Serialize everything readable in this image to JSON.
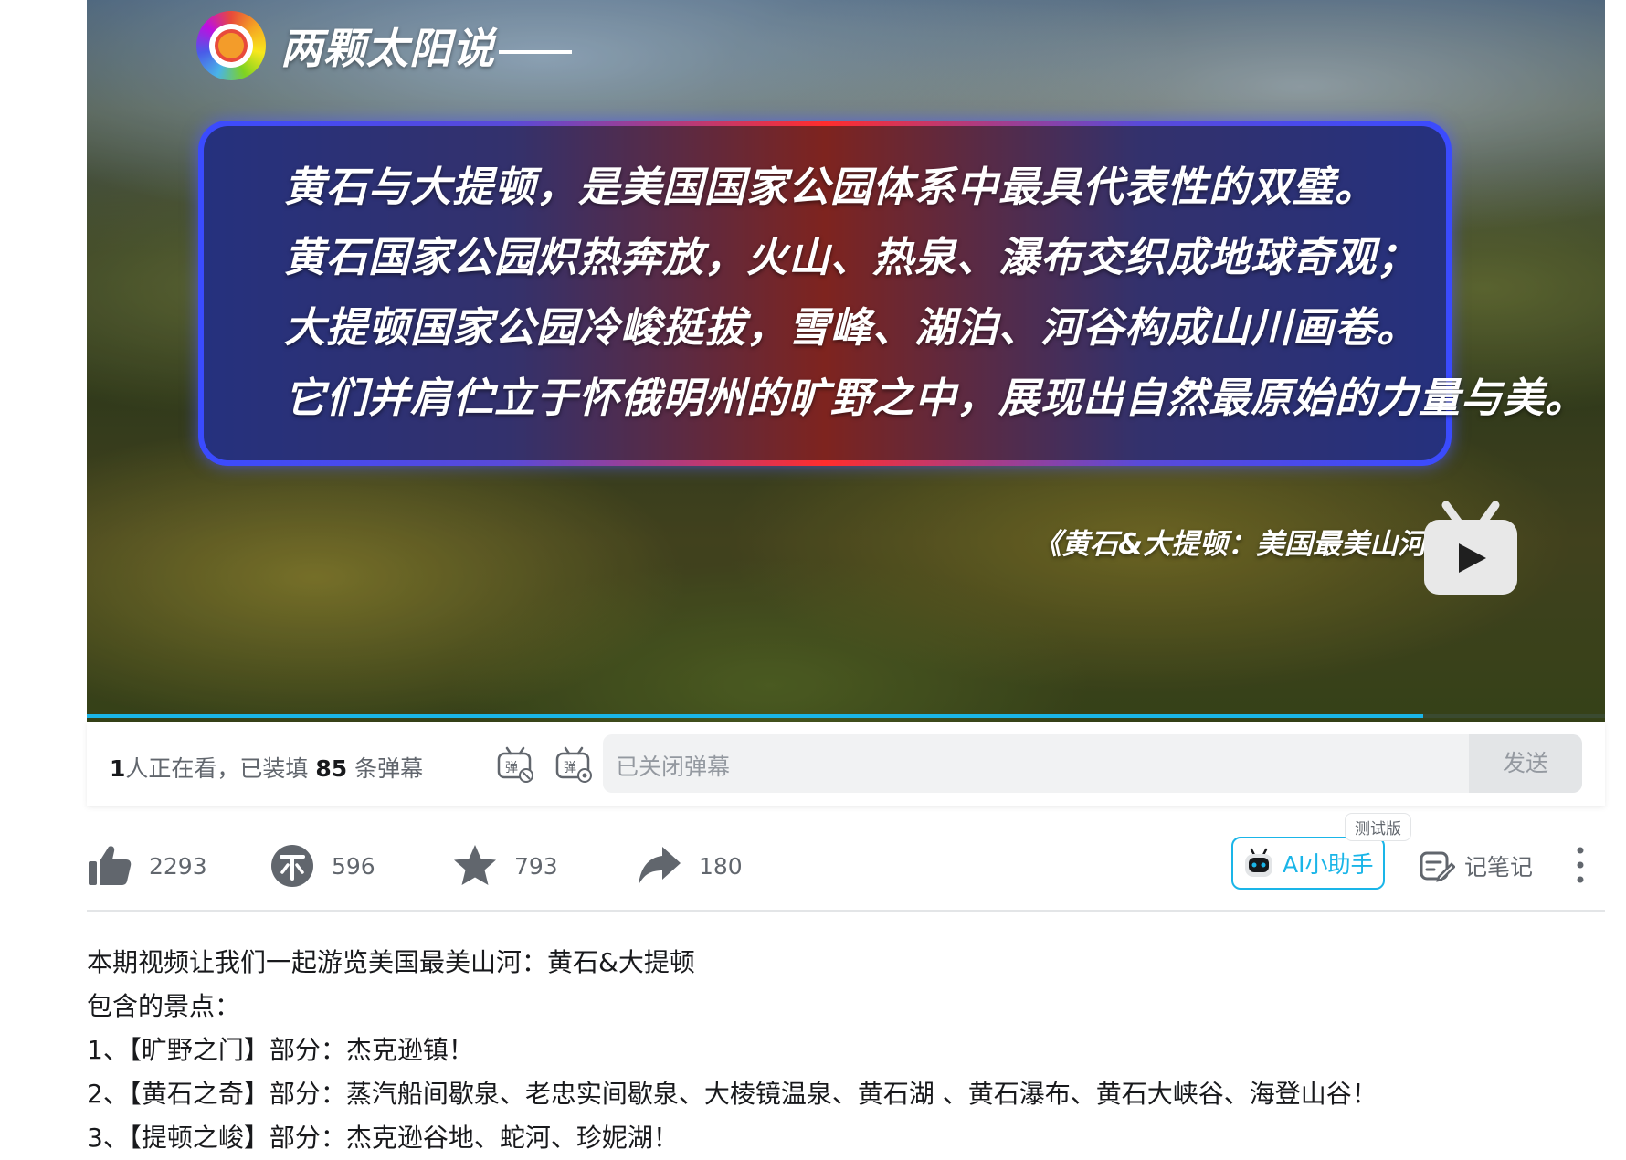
{
  "video": {
    "brand_name": "两颗太阳说",
    "quote_lines": [
      "黄石与大提顿，是美国国家公园体系中最具代表性的双璧。",
      "黄石国家公园炽热奔放，火山、热泉、瀑布交织成地球奇观；",
      "大提顿国家公园冷峻挺拔，雪峰、湖泊、河谷构成山川画卷。",
      "它们并肩伫立于怀俄明州的旷野之中，展现出自然最原始的力量与美。"
    ],
    "episode_title": "《黄石&大提顿：美国最美山河》",
    "progress": 0.88
  },
  "danmaku": {
    "viewers": "1",
    "viewers_text": "人正在看，已装填",
    "count": "85",
    "count_suffix": "条弹幕",
    "input_placeholder": "已关闭弹幕",
    "send_label": "发送"
  },
  "toolbar": {
    "like_count": "2293",
    "coin_count": "596",
    "favorite_count": "793",
    "share_count": "180",
    "ai_badge": "测试版",
    "ai_label": "AI小助手",
    "note_label": "记笔记"
  },
  "description": {
    "lines": [
      "本期视频让我们一起游览美国最美山河：黄石&大提顿",
      "包含的景点：",
      "1、【旷野之门】部分：杰克逊镇！",
      "2、【黄石之奇】部分：蒸汽船间歇泉、老忠实间歇泉、大棱镜温泉、黄石湖 、黄石瀑布、黄石大峡谷、海登山谷！",
      "3、【提顿之峻】部分：杰克逊谷地、蛇河、珍妮湖！"
    ]
  },
  "colors": {
    "accent": "#1ab5e8",
    "frame_blue": "#3a4bff",
    "frame_red": "#ff2d2d"
  }
}
